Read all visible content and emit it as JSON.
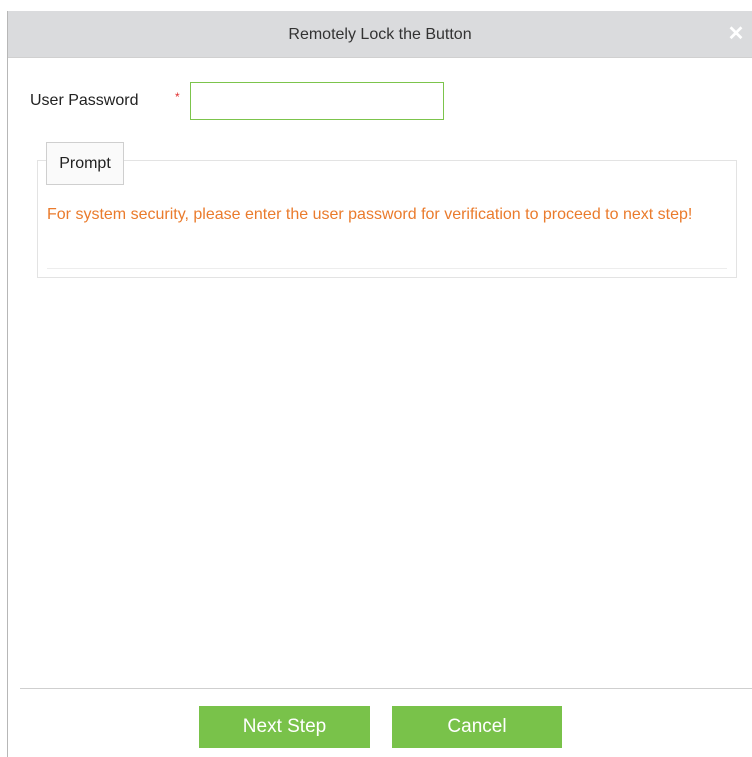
{
  "dialog": {
    "title": "Remotely Lock the Button",
    "close_icon": "close-icon",
    "close_glyph": "✕"
  },
  "form": {
    "password_label": "User Password",
    "required_mark": "*",
    "password_value": "",
    "password_placeholder": ""
  },
  "prompt": {
    "legend": "Prompt",
    "message": "For system security, please enter the user password for verification to proceed to next step!"
  },
  "footer": {
    "next_label": "Next Step",
    "cancel_label": "Cancel"
  },
  "colors": {
    "title_bar": "#dadbdd",
    "accent_green": "#79c24a",
    "input_border": "#7cc44c",
    "prompt_text": "#ea7b2c",
    "required": "#e03030"
  }
}
